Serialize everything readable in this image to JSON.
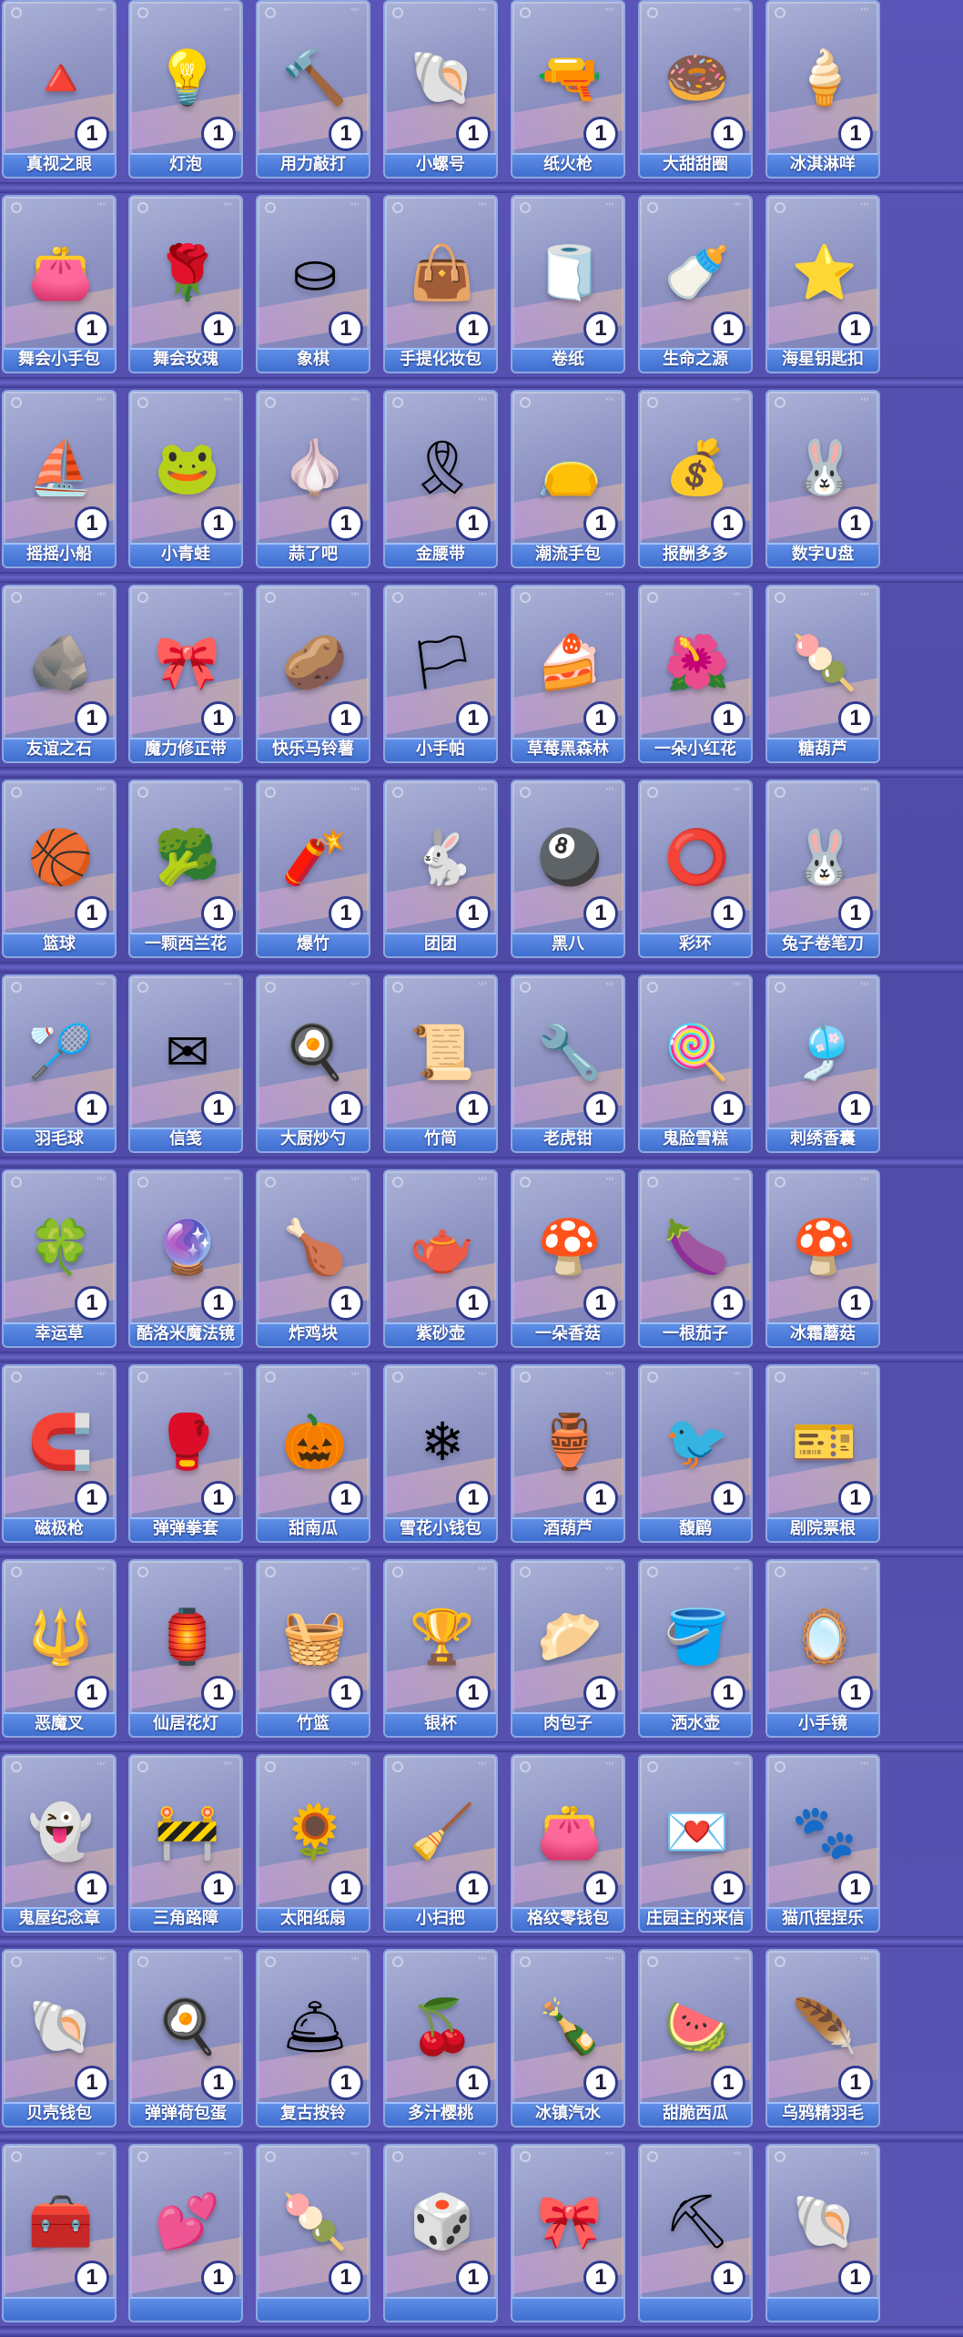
{
  "items": [
    {
      "name": "真视之眼",
      "count": "1",
      "icon": "pyramid-eye-icon",
      "glyph": "🔺"
    },
    {
      "name": "灯泡",
      "count": "1",
      "icon": "light-bulb-icon",
      "glyph": "💡"
    },
    {
      "name": "用力敲打",
      "count": "1",
      "icon": "hammer-icon",
      "glyph": "🔨"
    },
    {
      "name": "小螺号",
      "count": "1",
      "icon": "conch-shell-icon",
      "glyph": "🐚"
    },
    {
      "name": "纸火枪",
      "count": "1",
      "icon": "paper-gun-icon",
      "glyph": "🔫"
    },
    {
      "name": "大甜甜圈",
      "count": "1",
      "icon": "donut-icon",
      "glyph": "🍩"
    },
    {
      "name": "冰淇淋咩",
      "count": "1",
      "icon": "ice-cream-sheep-icon",
      "glyph": "🍦"
    },
    {
      "name": "舞会小手包",
      "count": "1",
      "icon": "handbag-icon",
      "glyph": "👛"
    },
    {
      "name": "舞会玫瑰",
      "count": "1",
      "icon": "rose-icon",
      "glyph": "🌹"
    },
    {
      "name": "象棋",
      "count": "1",
      "icon": "chess-piece-icon",
      "glyph": "⛀"
    },
    {
      "name": "手提化妆包",
      "count": "1",
      "icon": "makeup-bag-icon",
      "glyph": "👜"
    },
    {
      "name": "卷纸",
      "count": "1",
      "icon": "toilet-roll-icon",
      "glyph": "🧻"
    },
    {
      "name": "生命之源",
      "count": "1",
      "icon": "water-bottle-icon",
      "glyph": "🍼"
    },
    {
      "name": "海星钥匙扣",
      "count": "1",
      "icon": "starfish-keychain-icon",
      "glyph": "⭐"
    },
    {
      "name": "摇摇小船",
      "count": "1",
      "icon": "paper-boat-icon",
      "glyph": "⛵"
    },
    {
      "name": "小青蛙",
      "count": "1",
      "icon": "frog-icon",
      "glyph": "🐸"
    },
    {
      "name": "蒜了吧",
      "count": "1",
      "icon": "garlic-icon",
      "glyph": "🧄"
    },
    {
      "name": "金腰带",
      "count": "1",
      "icon": "gold-belt-icon",
      "glyph": "🎗"
    },
    {
      "name": "潮流手包",
      "count": "1",
      "icon": "clutch-bag-icon",
      "glyph": "👝"
    },
    {
      "name": "报酬多多",
      "count": "1",
      "icon": "money-bag-icon",
      "glyph": "💰"
    },
    {
      "name": "数字U盘",
      "count": "1",
      "icon": "usb-drive-icon",
      "glyph": "🐰"
    },
    {
      "name": "友谊之石",
      "count": "1",
      "icon": "stone-icon",
      "glyph": "🪨"
    },
    {
      "name": "魔力修正带",
      "count": "1",
      "icon": "correction-tape-icon",
      "glyph": "🎀"
    },
    {
      "name": "快乐马铃薯",
      "count": "1",
      "icon": "potato-character-icon",
      "glyph": "🥔"
    },
    {
      "name": "小手帕",
      "count": "1",
      "icon": "handkerchief-icon",
      "glyph": "🏳"
    },
    {
      "name": "草莓黑森林",
      "count": "1",
      "icon": "cake-icon",
      "glyph": "🍰"
    },
    {
      "name": "一朵小红花",
      "count": "1",
      "icon": "red-flower-icon",
      "glyph": "🌺"
    },
    {
      "name": "糖葫芦",
      "count": "1",
      "icon": "candied-haws-icon",
      "glyph": "🍡"
    },
    {
      "name": "篮球",
      "count": "1",
      "icon": "basketball-icon",
      "glyph": "🏀"
    },
    {
      "name": "一颗西兰花",
      "count": "1",
      "icon": "broccoli-icon",
      "glyph": "🥦"
    },
    {
      "name": "爆竹",
      "count": "1",
      "icon": "firecracker-icon",
      "glyph": "🧨"
    },
    {
      "name": "团团",
      "count": "1",
      "icon": "balloon-rabbit-icon",
      "glyph": "🐇"
    },
    {
      "name": "黑八",
      "count": "1",
      "icon": "eight-ball-icon",
      "glyph": "🎱"
    },
    {
      "name": "彩环",
      "count": "1",
      "icon": "color-ring-icon",
      "glyph": "⭕"
    },
    {
      "name": "兔子卷笔刀",
      "count": "1",
      "icon": "rabbit-sharpener-icon",
      "glyph": "🐰"
    },
    {
      "name": "羽毛球",
      "count": "1",
      "icon": "shuttlecock-icon",
      "glyph": "🏸"
    },
    {
      "name": "信笺",
      "count": "1",
      "icon": "envelope-icon",
      "glyph": "✉"
    },
    {
      "name": "大厨炒勺",
      "count": "1",
      "icon": "ladle-icon",
      "glyph": "🍳"
    },
    {
      "name": "竹简",
      "count": "1",
      "icon": "bamboo-scroll-icon",
      "glyph": "📜"
    },
    {
      "name": "老虎钳",
      "count": "1",
      "icon": "pliers-icon",
      "glyph": "🔧"
    },
    {
      "name": "鬼脸雪糕",
      "count": "1",
      "icon": "popsicle-icon",
      "glyph": "🍭"
    },
    {
      "name": "刺绣香囊",
      "count": "1",
      "icon": "sachet-icon",
      "glyph": "🎐"
    },
    {
      "name": "幸运草",
      "count": "1",
      "icon": "clover-icon",
      "glyph": "🍀"
    },
    {
      "name": "酷洛米魔法镜",
      "count": "1",
      "icon": "magic-mirror-icon",
      "glyph": "🔮"
    },
    {
      "name": "炸鸡块",
      "count": "1",
      "icon": "nugget-icon",
      "glyph": "🍗"
    },
    {
      "name": "紫砂壶",
      "count": "1",
      "icon": "teapot-icon",
      "glyph": "🫖"
    },
    {
      "name": "一朵香菇",
      "count": "1",
      "icon": "mushroom-icon",
      "glyph": "🍄"
    },
    {
      "name": "一根茄子",
      "count": "1",
      "icon": "eggplant-icon",
      "glyph": "🍆"
    },
    {
      "name": "冰霜蘑菇",
      "count": "1",
      "icon": "frost-mushroom-icon",
      "glyph": "🍄"
    },
    {
      "name": "磁极枪",
      "count": "1",
      "icon": "magnet-gun-icon",
      "glyph": "🧲"
    },
    {
      "name": "弹弹拳套",
      "count": "1",
      "icon": "boxing-glove-icon",
      "glyph": "🥊"
    },
    {
      "name": "甜南瓜",
      "count": "1",
      "icon": "pumpkin-icon",
      "glyph": "🎃"
    },
    {
      "name": "雪花小钱包",
      "count": "1",
      "icon": "snowflake-wallet-icon",
      "glyph": "❄"
    },
    {
      "name": "酒葫芦",
      "count": "1",
      "icon": "gourd-icon",
      "glyph": "🏺"
    },
    {
      "name": "馥鹛",
      "count": "1",
      "icon": "bird-icon",
      "glyph": "🐦"
    },
    {
      "name": "剧院票根",
      "count": "1",
      "icon": "ticket-icon",
      "glyph": "🎫"
    },
    {
      "name": "恶魔叉",
      "count": "1",
      "icon": "trident-icon",
      "glyph": "🔱"
    },
    {
      "name": "仙居花灯",
      "count": "1",
      "icon": "lantern-icon",
      "glyph": "🏮"
    },
    {
      "name": "竹篮",
      "count": "1",
      "icon": "basket-icon",
      "glyph": "🧺"
    },
    {
      "name": "银杯",
      "count": "1",
      "icon": "silver-cup-icon",
      "glyph": "🏆"
    },
    {
      "name": "肉包子",
      "count": "1",
      "icon": "bun-icon",
      "glyph": "🥟"
    },
    {
      "name": "洒水壶",
      "count": "1",
      "icon": "watering-can-icon",
      "glyph": "🪣"
    },
    {
      "name": "小手镜",
      "count": "1",
      "icon": "hand-mirror-icon",
      "glyph": "🪞"
    },
    {
      "name": "鬼屋纪念章",
      "count": "1",
      "icon": "ghost-badge-icon",
      "glyph": "👻"
    },
    {
      "name": "三角路障",
      "count": "1",
      "icon": "traffic-cone-icon",
      "glyph": "🚧"
    },
    {
      "name": "太阳纸扇",
      "count": "1",
      "icon": "sun-fan-icon",
      "glyph": "🌻"
    },
    {
      "name": "小扫把",
      "count": "1",
      "icon": "broom-icon",
      "glyph": "🧹"
    },
    {
      "name": "格纹零钱包",
      "count": "1",
      "icon": "coin-purse-icon",
      "glyph": "👛"
    },
    {
      "name": "庄园主的来信",
      "count": "1",
      "icon": "letter-icon",
      "glyph": "💌"
    },
    {
      "name": "猫爪捏捏乐",
      "count": "1",
      "icon": "cat-paw-icon",
      "glyph": "🐾"
    },
    {
      "name": "贝壳钱包",
      "count": "1",
      "icon": "shell-purse-icon",
      "glyph": "🐚"
    },
    {
      "name": "弹弹荷包蛋",
      "count": "1",
      "icon": "fried-egg-icon",
      "glyph": "🍳"
    },
    {
      "name": "复古按铃",
      "count": "1",
      "icon": "service-bell-icon",
      "glyph": "🛎"
    },
    {
      "name": "多汁樱桃",
      "count": "1",
      "icon": "cherry-icon",
      "glyph": "🍒"
    },
    {
      "name": "冰镇汽水",
      "count": "1",
      "icon": "soda-bottle-icon",
      "glyph": "🍾"
    },
    {
      "name": "甜脆西瓜",
      "count": "1",
      "icon": "watermelon-icon",
      "glyph": "🍉"
    },
    {
      "name": "乌鸦精羽毛",
      "count": "1",
      "icon": "feather-icon",
      "glyph": "🪶"
    },
    {
      "name": "",
      "count": "1",
      "icon": "treasure-chest-icon",
      "glyph": "🧰"
    },
    {
      "name": "",
      "count": "1",
      "icon": "heart-pillow-icon",
      "glyph": "💕"
    },
    {
      "name": "",
      "count": "1",
      "icon": "lollipop-icon",
      "glyph": "🍡"
    },
    {
      "name": "",
      "count": "1",
      "icon": "dice-icon",
      "glyph": "🎲"
    },
    {
      "name": "",
      "count": "1",
      "icon": "bow-tie-icon",
      "glyph": "🎀"
    },
    {
      "name": "",
      "count": "1",
      "icon": "sickle-icon",
      "glyph": "⛏"
    },
    {
      "name": "",
      "count": "1",
      "icon": "seashell-icon",
      "glyph": "🐚"
    }
  ],
  "colors": {
    "name_bar": "#4a7ddc",
    "count_border": "#2f3a8f",
    "background": "#5a55b8"
  }
}
